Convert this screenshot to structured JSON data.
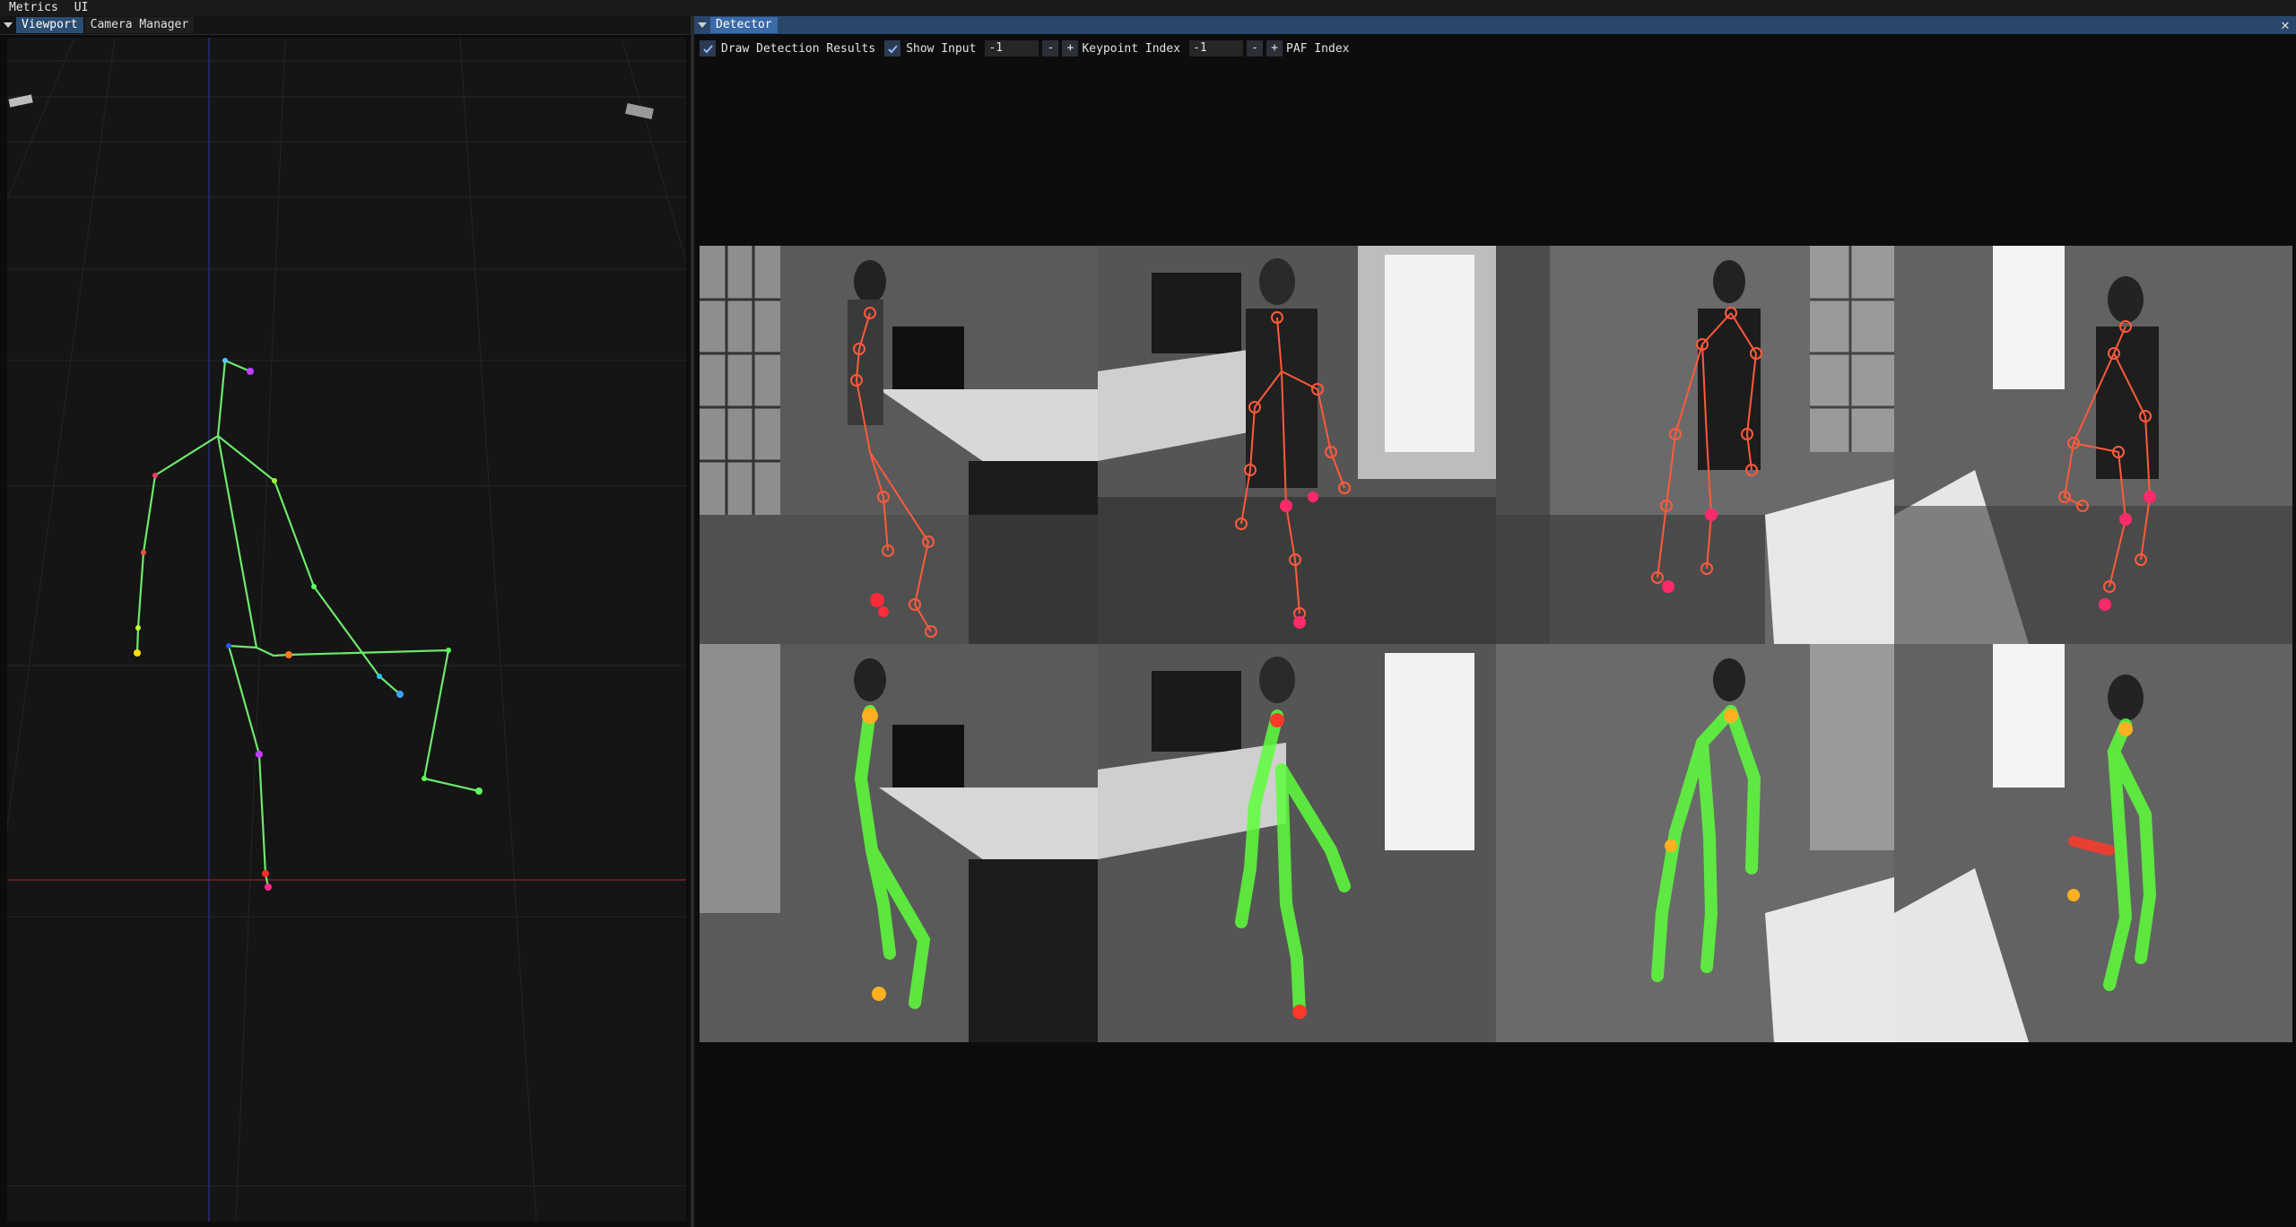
{
  "menubar": {
    "items": [
      "Metrics",
      "UI"
    ]
  },
  "left_window": {
    "tabs": [
      "Viewport",
      "Camera Manager"
    ],
    "active_tab": 0
  },
  "right_window": {
    "title": "Detector",
    "controls": {
      "draw_detection_results_label": "Draw Detection Results",
      "draw_detection_results_checked": true,
      "show_input_label": "Show Input",
      "show_input_checked": true,
      "keypoint_value": "-1",
      "keypoint_label": "Keypoint Index",
      "paf_value": "-1",
      "paf_label": "PAF Index",
      "minus": "-",
      "plus": "+"
    }
  },
  "colors": {
    "skeleton": "#4be04b",
    "keypoint_ring": "#ff5a3c",
    "tab_active": "#2c4d72",
    "title_bar": "#29466b",
    "grid_red_axis": "#7a2222",
    "grid_blue_axis": "#2a2a7a"
  },
  "icons": [
    "collapse-arrow-icon",
    "close-icon",
    "checkmark-icon"
  ],
  "detector_grid": {
    "rows": 2,
    "cols": 4,
    "row_modes": [
      "keypoints",
      "part-affinity-fields"
    ]
  }
}
